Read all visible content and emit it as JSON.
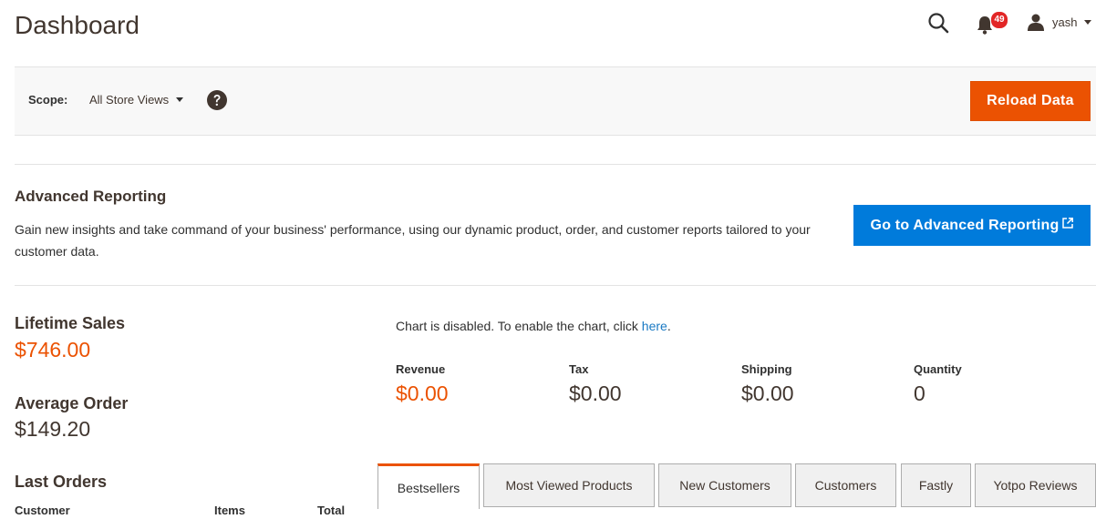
{
  "header": {
    "title": "Dashboard",
    "notifications_count": "49",
    "user_name": "yash",
    "icons": [
      "search-icon",
      "bell-icon",
      "user-icon",
      "caret-down-icon"
    ]
  },
  "scope": {
    "label": "Scope:",
    "selected": "All Store Views",
    "reload_label": "Reload Data"
  },
  "advanced_reporting": {
    "title": "Advanced Reporting",
    "description": "Gain new insights and take command of your business' performance, using our dynamic product, order, and customer reports tailored to your customer data.",
    "button_label": "Go to Advanced Reporting"
  },
  "stats": {
    "lifetime_sales_label": "Lifetime Sales",
    "lifetime_sales_value": "$746.00",
    "average_order_label": "Average Order",
    "average_order_value": "$149.20"
  },
  "chart": {
    "message": "Chart is disabled. To enable the chart, click ",
    "link_text": "here",
    "message_end": "."
  },
  "totals": [
    {
      "label": "Revenue",
      "value": "$0.00"
    },
    {
      "label": "Tax",
      "value": "$0.00"
    },
    {
      "label": "Shipping",
      "value": "$0.00"
    },
    {
      "label": "Quantity",
      "value": "0"
    }
  ],
  "last_orders": {
    "title": "Last Orders",
    "columns": [
      "Customer",
      "Items",
      "Total"
    ]
  },
  "tabs": [
    "Bestsellers",
    "Most Viewed Products",
    "New Customers",
    "Customers",
    "Fastly",
    "Yotpo Reviews"
  ],
  "colors": {
    "accent_orange": "#eb5202",
    "primary_blue": "#007bdb",
    "link_blue": "#1979c3",
    "badge_red": "#e22626"
  }
}
